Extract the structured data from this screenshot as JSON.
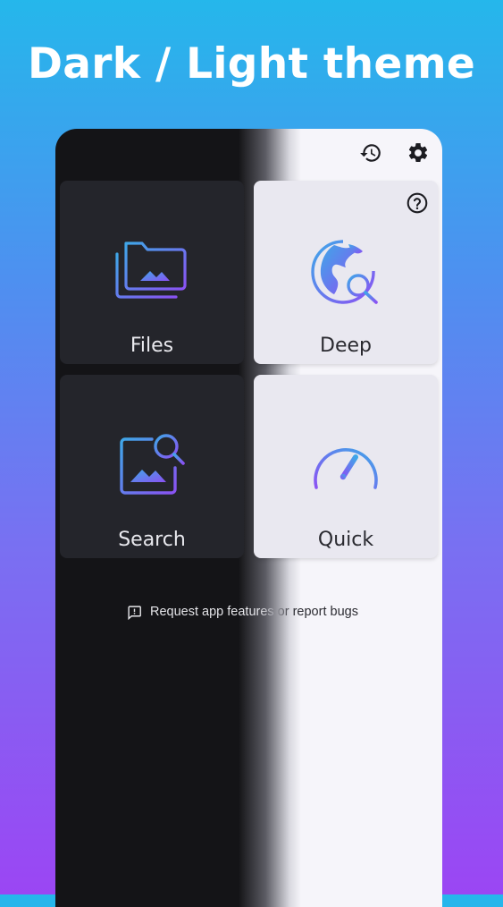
{
  "headline": "Dark / Light theme",
  "toolbar": {
    "history_icon": "history-icon",
    "settings_icon": "gear-icon",
    "help_icon": "help-circle-icon"
  },
  "tiles": [
    {
      "label": "Files",
      "icon": "folder-image-icon",
      "theme": "dark"
    },
    {
      "label": "Deep",
      "icon": "globe-search-icon",
      "theme": "light"
    },
    {
      "label": "Search",
      "icon": "image-search-icon",
      "theme": "dark"
    },
    {
      "label": "Quick",
      "icon": "speedometer-icon",
      "theme": "light"
    }
  ],
  "footer": {
    "report_label": "Request app features or report bugs",
    "report_icon": "feedback-icon"
  },
  "colors": {
    "gradient_start": "#22b8e9",
    "gradient_end": "#a040f5",
    "dark_bg": "#141417",
    "dark_tile": "#24252b",
    "light_bg": "#f6f5fa",
    "light_tile": "#e9e8f0",
    "icon_gradient_start": "#3fa0e8",
    "icon_gradient_end": "#8b5cf6"
  }
}
